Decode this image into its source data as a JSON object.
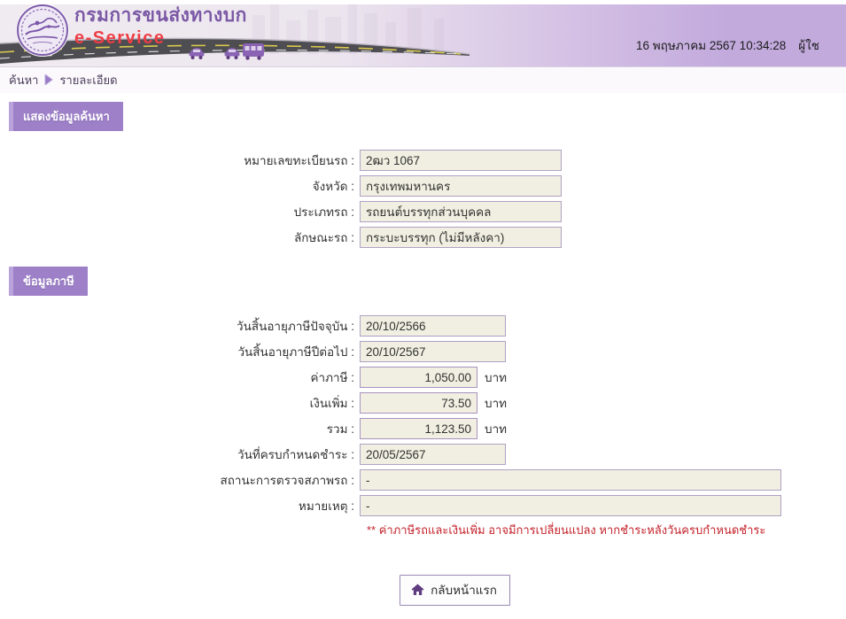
{
  "colors": {
    "accent_purple": "#9d80c8",
    "header_lavender": "#c2aadd",
    "brand_purple": "#7a58a5",
    "brand_red": "#ee3e45",
    "field_background": "#f0efe1",
    "field_border": "#b0a1c4",
    "note_red": "#c4232b"
  },
  "header": {
    "agency_name": "กรมการขนส่งทางบก",
    "service_name": "e-Service",
    "datetime": "16 พฤษภาคม 2567 10:34:28",
    "user_label": "ผู้ใช"
  },
  "breadcrumb": {
    "search": "ค้นหา",
    "detail": "รายละเอียด"
  },
  "search_section": {
    "title": "แสดงข้อมูลค้นหา",
    "fields": [
      {
        "label": "หมายเลขทะเบียนรถ :",
        "value": "2ฒว 1067"
      },
      {
        "label": "จังหวัด :",
        "value": "กรุงเทพมหานคร"
      },
      {
        "label": "ประเภทรถ :",
        "value": "รถยนต์บรรทุกส่วนบุคคล"
      },
      {
        "label": "ลักษณะรถ :",
        "value": "กระบะบรรทุก (ไม่มีหลังคา)"
      }
    ]
  },
  "tax_section": {
    "title": "ข้อมูลภาษี",
    "fields": [
      {
        "label": "วันสิ้นอายุภาษีปัจจุบัน :",
        "value": "20/10/2566"
      },
      {
        "label": "วันสิ้นอายุภาษีปีต่อไป :",
        "value": "20/10/2567"
      },
      {
        "label": "ค่าภาษี :",
        "value": "1,050.00",
        "unit": "บาท"
      },
      {
        "label": "เงินเพิ่ม :",
        "value": "73.50",
        "unit": "บาท"
      },
      {
        "label": "รวม :",
        "value": "1,123.50",
        "unit": "บาท"
      },
      {
        "label": "วันที่ครบกำหนดชำระ :",
        "value": "20/05/2567"
      },
      {
        "label": "สถานะการตรวจสภาพรถ :",
        "value": "-"
      },
      {
        "label": "หมายเหตุ :",
        "value": "-"
      }
    ],
    "note": "** ค่าภาษีรถและเงินเพิ่ม อาจมีการเปลี่ยนแปลง หากชำระหลังวันครบกำหนดชำระ"
  },
  "footer": {
    "home_button": "กลับหน้าแรก"
  }
}
